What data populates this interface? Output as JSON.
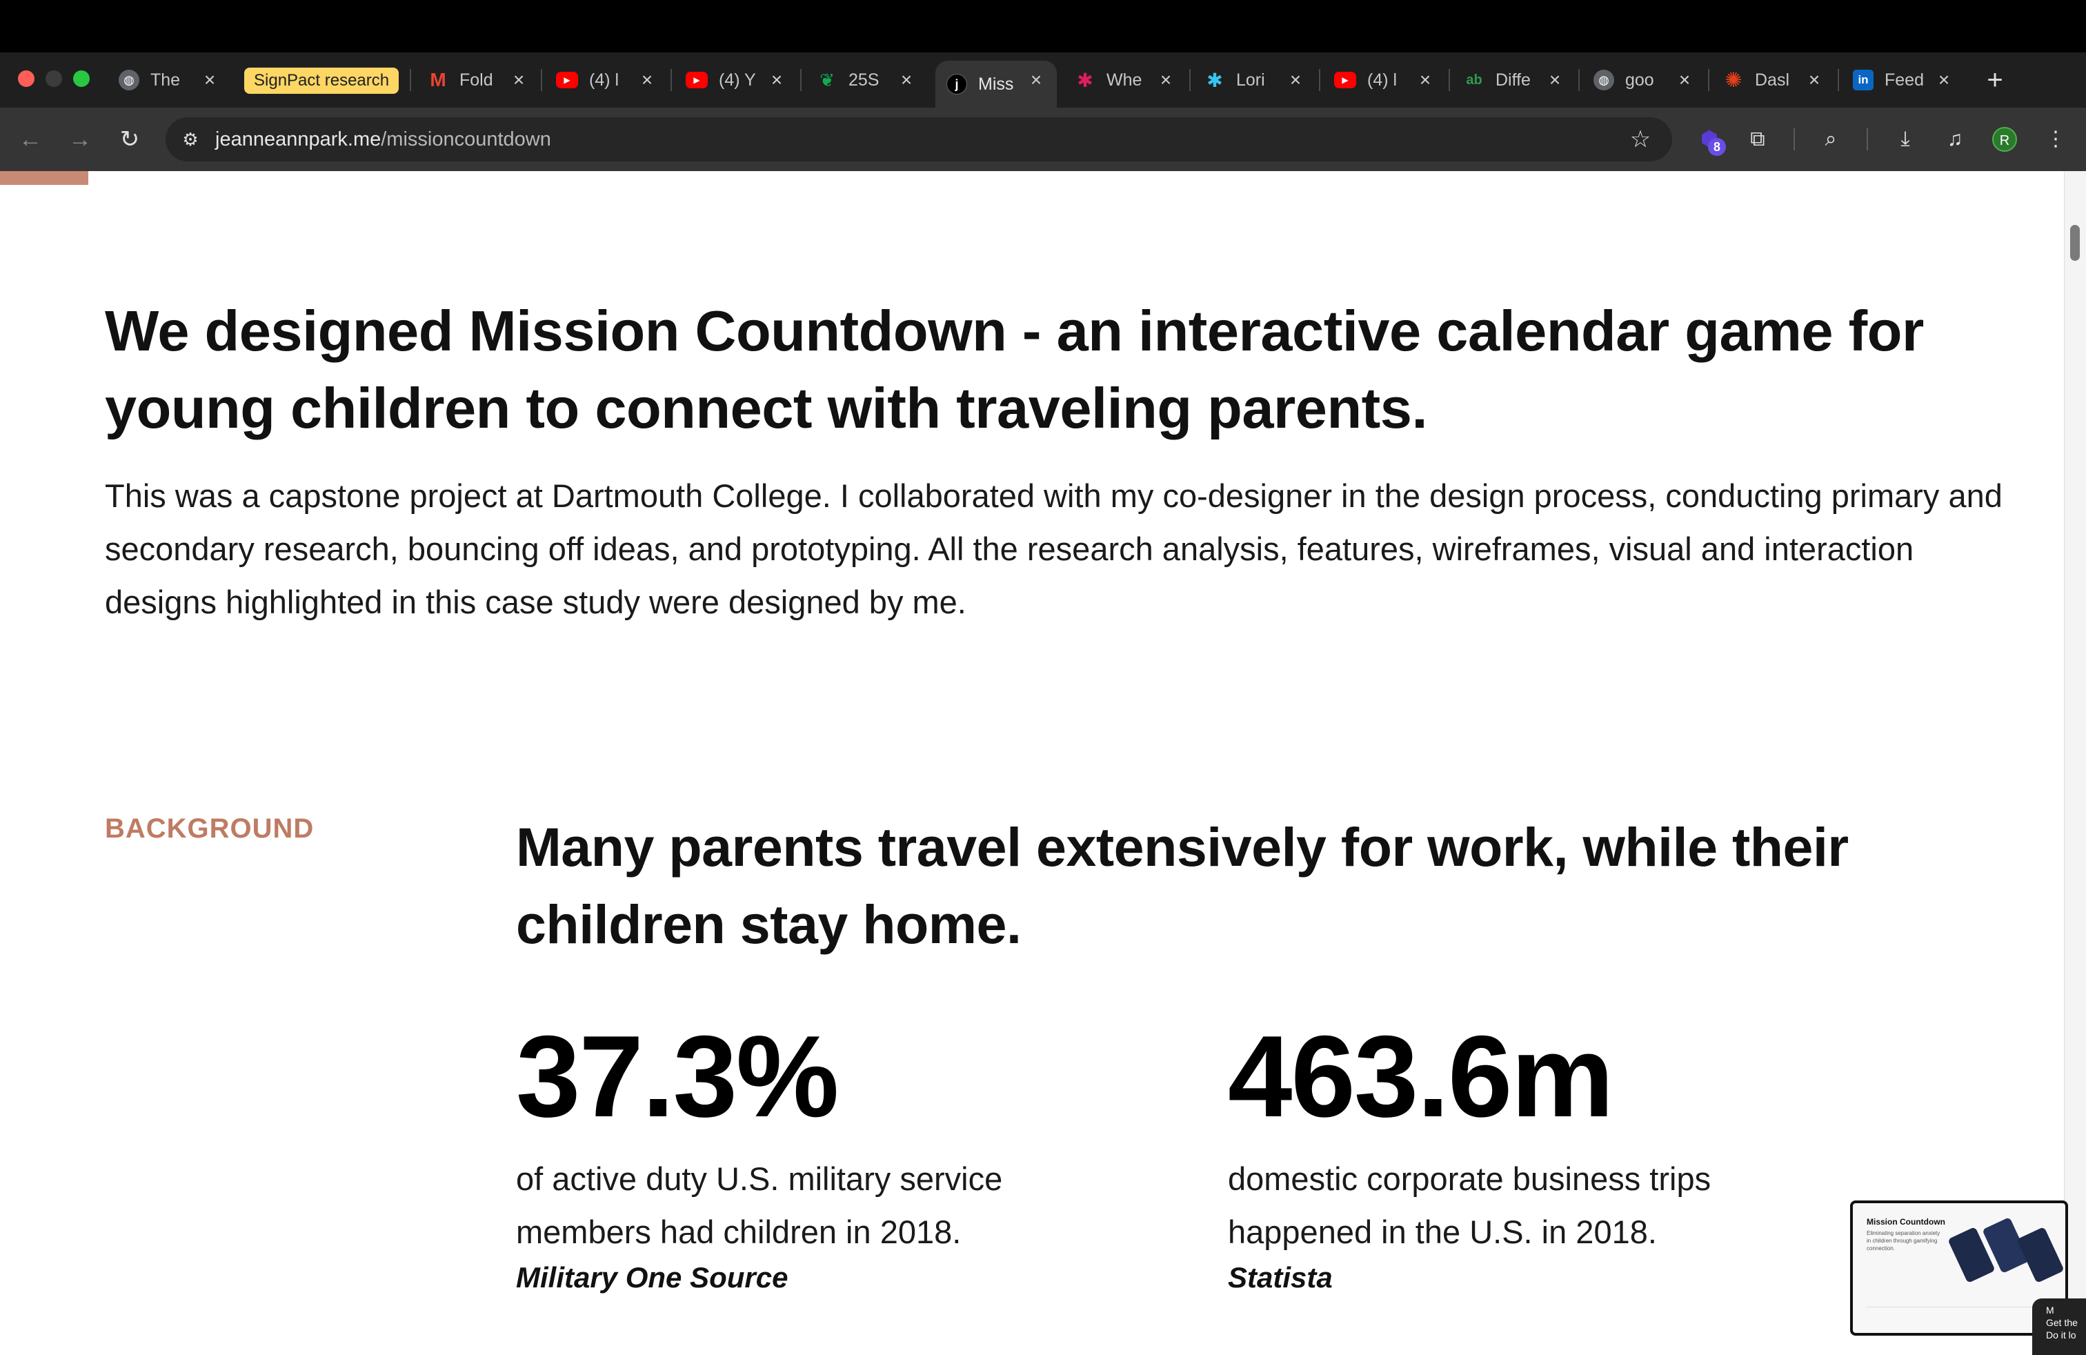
{
  "browser": {
    "tabs": [
      {
        "title": "The",
        "icon": "globe-icon",
        "color": "#5f6368",
        "glyph": "◍"
      },
      {
        "title": "Fold",
        "icon": "gmail-icon",
        "color": "#d93025",
        "glyph": "M"
      },
      {
        "title": "(4) l",
        "icon": "youtube-icon",
        "color": "#ff0000",
        "glyph": "▶"
      },
      {
        "title": "(4) Y",
        "icon": "youtube-icon",
        "color": "#ff0000",
        "glyph": "▶"
      },
      {
        "title": "25S",
        "icon": "mongodb-icon",
        "color": "#00684a",
        "glyph": "❦"
      },
      {
        "title": "Miss",
        "icon": "jeanne-site-icon",
        "color": "#000000",
        "glyph": "j"
      },
      {
        "title": "Whe",
        "icon": "slack-icon",
        "color": "#4a154b",
        "glyph": "✱"
      },
      {
        "title": "Lori",
        "icon": "slack-icon",
        "color": "#4a154b",
        "glyph": "✱"
      },
      {
        "title": "(4) l",
        "icon": "youtube-icon",
        "color": "#ff0000",
        "glyph": "▶"
      },
      {
        "title": "Diffe",
        "icon": "diff-icon",
        "color": "#1f6f3f",
        "glyph": "ab"
      },
      {
        "title": "goo",
        "icon": "globe-icon",
        "color": "#5f6368",
        "glyph": "◍"
      },
      {
        "title": "Dasl",
        "icon": "canvas-icon",
        "color": "#e2401c",
        "glyph": "✺"
      },
      {
        "title": "Feed",
        "icon": "linkedin-icon",
        "color": "#0a66c2",
        "glyph": "in"
      }
    ],
    "tab_group_label": "SignPact research",
    "url_host": "jeanneannpark.me",
    "url_path": "/missioncountdown",
    "extension_badge": "8",
    "profile_initial": "R"
  },
  "page": {
    "headline": "We designed Mission Countdown - an interactive calendar game for young children to connect with traveling parents.",
    "intro": "This was a capstone project at Dartmouth College. I collaborated with my co-designer in the design process, conducting primary and secondary research, bouncing off ideas, and prototyping. All the research analysis, features, wireframes, visual and interaction designs highlighted in this case study were designed by me.",
    "section_label": "BACKGROUND",
    "section_heading": "Many parents travel extensively for work, while their children stay home.",
    "stats": [
      {
        "value": "37.3%",
        "description": "of active duty U.S. military service members had children in 2018.",
        "source": "Military One Source"
      },
      {
        "value": "463.6m",
        "description": "domestic corporate business trips happened in the U.S. in 2018.",
        "source": "Statista"
      }
    ],
    "accent_color": "#bf7b63"
  },
  "pip": {
    "title": "Mission Countdown",
    "subtitle": "Eliminating separation anxiety in children through gamifying connection."
  },
  "toast": {
    "line1": "M",
    "line2": "Get the",
    "line3": "Do it lo"
  }
}
